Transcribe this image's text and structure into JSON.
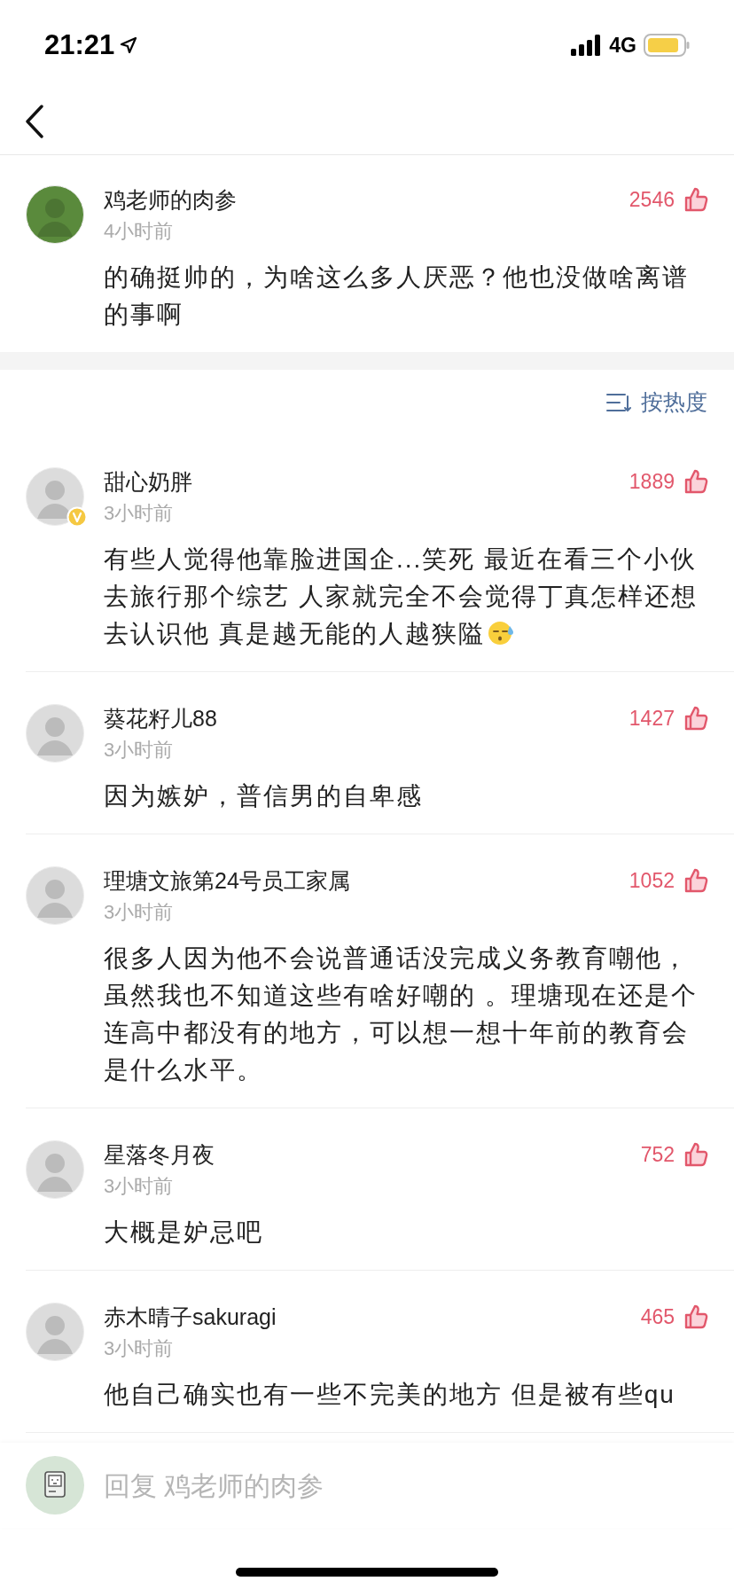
{
  "status_bar": {
    "time": "21:21",
    "network": "4G"
  },
  "post": {
    "author": "鸡老师的肉参",
    "time": "4小时前",
    "likes": "2546",
    "text": "的确挺帅的，为啥这么多人厌恶？他也没做啥离谱的事啊"
  },
  "sort": {
    "label": "按热度"
  },
  "comments": [
    {
      "author": "甜心奶胖",
      "verified": true,
      "time": "3小时前",
      "likes": "1889",
      "text": "有些人觉得他靠脸进国企...笑死 最近在看三个小伙去旅行那个综艺  人家就完全不会觉得丁真怎样还想去认识他  真是越无能的人越狭隘",
      "emoji": true
    },
    {
      "author": "葵花籽儿88",
      "verified": false,
      "time": "3小时前",
      "likes": "1427",
      "text": "因为嫉妒，普信男的自卑感",
      "emoji": false
    },
    {
      "author": "理塘文旅第24号员工家属",
      "verified": false,
      "time": "3小时前",
      "likes": "1052",
      "text": "很多人因为他不会说普通话没完成义务教育嘲他，虽然我也不知道这些有啥好嘲的 。理塘现在还是个连高中都没有的地方，可以想一想十年前的教育会是什么水平。",
      "emoji": false
    },
    {
      "author": "星落冬月夜",
      "verified": false,
      "time": "3小时前",
      "likes": "752",
      "text": "大概是妒忌吧",
      "emoji": false
    },
    {
      "author": "赤木晴子sakuragi",
      "verified": false,
      "time": "3小时前",
      "likes": "465",
      "text": "他自己确实也有一些不完美的地方 但是被有些qu",
      "emoji": false
    }
  ],
  "reply": {
    "placeholder": "回复 鸡老师的肉参"
  }
}
